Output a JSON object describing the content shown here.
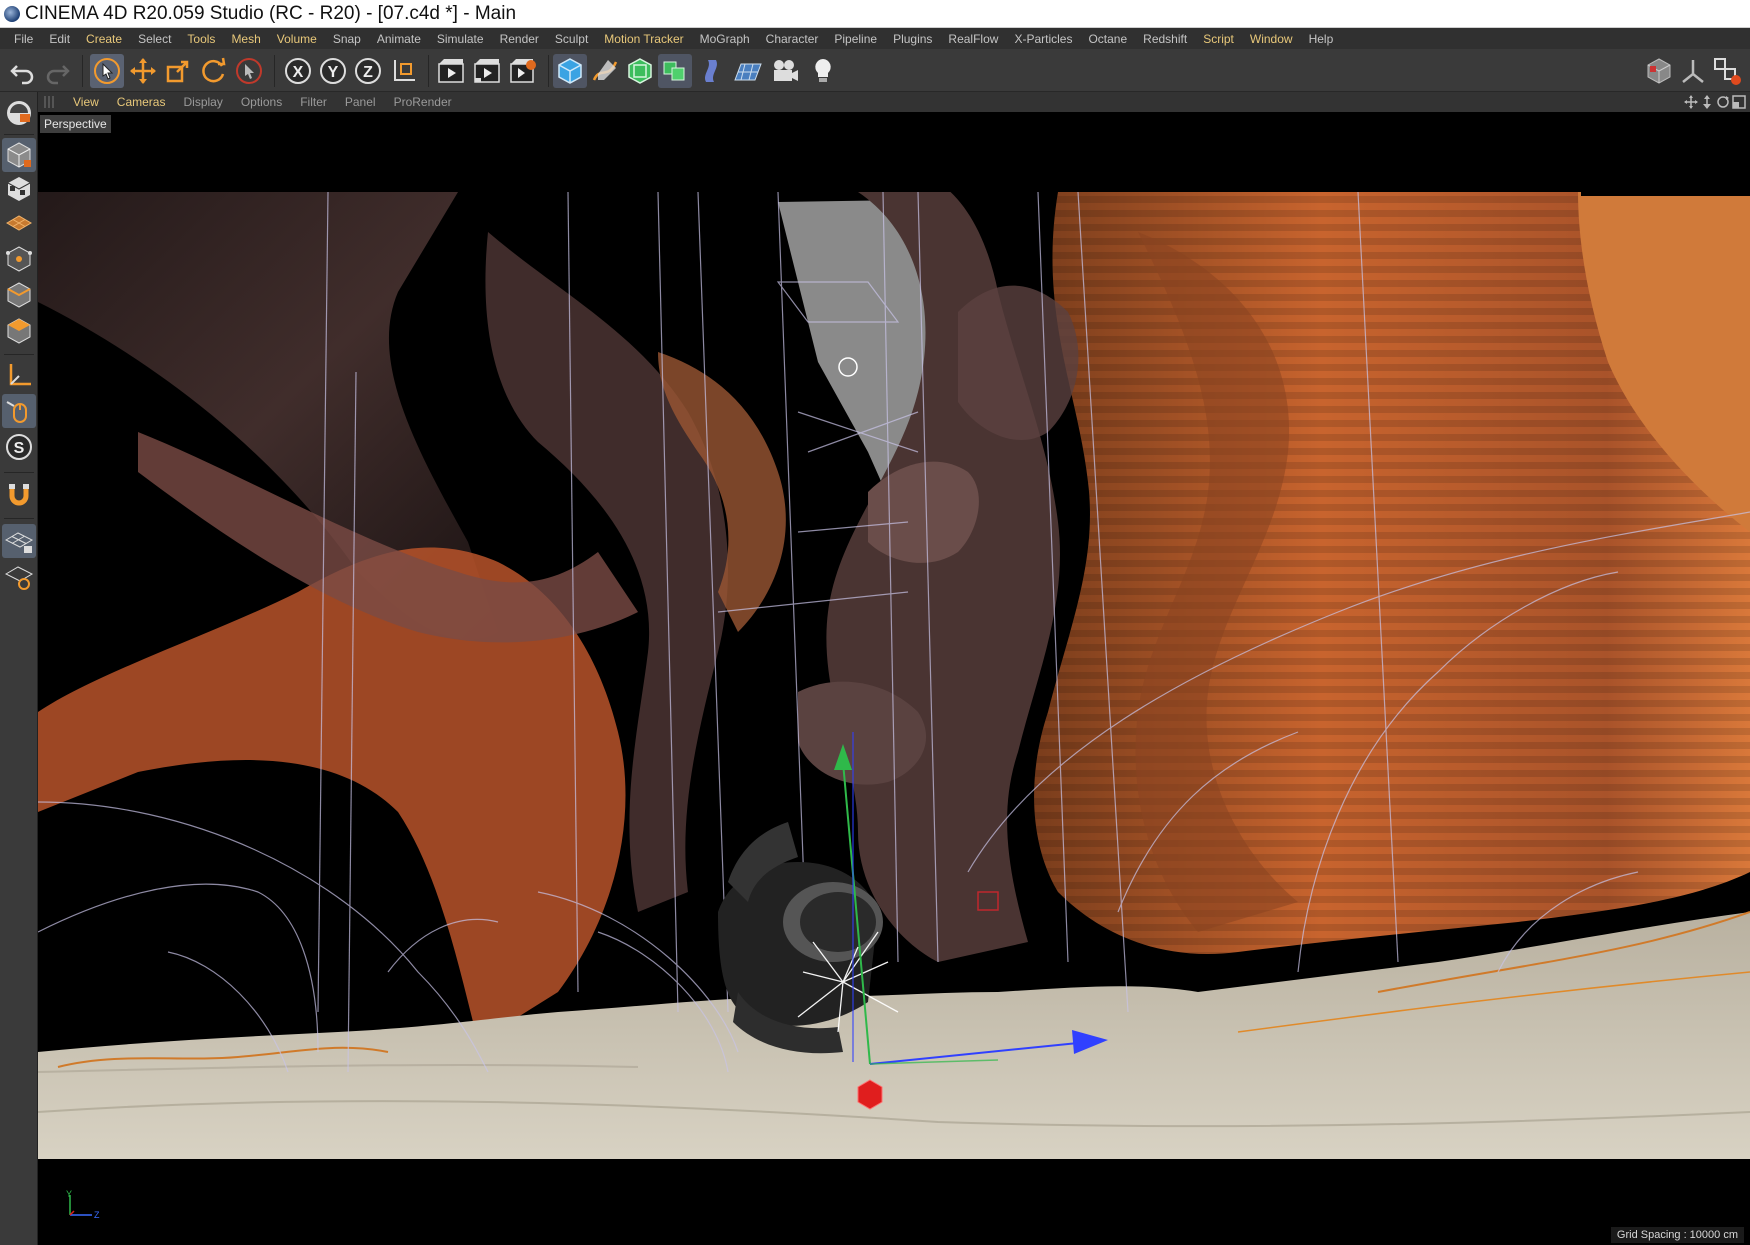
{
  "window": {
    "title": "CINEMA 4D R20.059 Studio (RC - R20) - [07.c4d *] - Main",
    "icon": "cinema4d-logo-icon"
  },
  "menubar": {
    "items": [
      {
        "label": "File",
        "highlight": false
      },
      {
        "label": "Edit",
        "highlight": false
      },
      {
        "label": "Create",
        "highlight": true
      },
      {
        "label": "Select",
        "highlight": false
      },
      {
        "label": "Tools",
        "highlight": true
      },
      {
        "label": "Mesh",
        "highlight": true
      },
      {
        "label": "Volume",
        "highlight": true
      },
      {
        "label": "Snap",
        "highlight": false
      },
      {
        "label": "Animate",
        "highlight": false
      },
      {
        "label": "Simulate",
        "highlight": false
      },
      {
        "label": "Render",
        "highlight": false
      },
      {
        "label": "Sculpt",
        "highlight": false
      },
      {
        "label": "Motion Tracker",
        "highlight": true
      },
      {
        "label": "MoGraph",
        "highlight": false
      },
      {
        "label": "Character",
        "highlight": false
      },
      {
        "label": "Pipeline",
        "highlight": false
      },
      {
        "label": "Plugins",
        "highlight": false
      },
      {
        "label": "RealFlow",
        "highlight": false
      },
      {
        "label": "X-Particles",
        "highlight": false
      },
      {
        "label": "Octane",
        "highlight": false
      },
      {
        "label": "Redshift",
        "highlight": false
      },
      {
        "label": "Script",
        "highlight": true
      },
      {
        "label": "Window",
        "highlight": true
      },
      {
        "label": "Help",
        "highlight": false
      }
    ]
  },
  "toolbar": {
    "buttons": [
      "undo-icon",
      "redo-icon",
      "live-selection-icon",
      "move-icon",
      "scale-icon",
      "rotate-icon",
      "recent-tool-icon",
      "x-axis-lock-icon",
      "y-axis-lock-icon",
      "z-axis-lock-icon",
      "coordinate-system-icon",
      "render-view-icon",
      "render-picture-viewer-icon",
      "edit-render-settings-icon",
      "cube-icon",
      "pen-spline-icon",
      "subdivision-surface-icon",
      "array-icon",
      "deformer-icon",
      "floor-icon",
      "camera-icon",
      "light-icon"
    ],
    "right_buttons": [
      "layout-icon",
      "snap-icon",
      "workplane-icon"
    ]
  },
  "left_palette": {
    "buttons": [
      "make-editable-icon",
      "texture-mode-icon",
      "workplane-mode-icon",
      "points-mode-icon",
      "edges-mode-icon",
      "polygons-mode-icon",
      "enable-axis-icon",
      "tweak-mode-icon",
      "solo-mode-icon",
      "snapping-icon",
      "workplane-lock-icon",
      "workplane-align-icon"
    ],
    "solo_glyph": "S"
  },
  "viewport_menu": {
    "items": [
      {
        "label": "View",
        "highlight": true
      },
      {
        "label": "Cameras",
        "highlight": true
      },
      {
        "label": "Display",
        "highlight": false
      },
      {
        "label": "Options",
        "highlight": false
      },
      {
        "label": "Filter",
        "highlight": false
      },
      {
        "label": "Panel",
        "highlight": false
      },
      {
        "label": "ProRender",
        "highlight": false
      }
    ],
    "controls": [
      "pan-icon",
      "zoom-icon",
      "orbit-icon",
      "maximize-icon"
    ]
  },
  "viewport": {
    "camera_label": "Perspective",
    "grid_spacing": "Grid Spacing : 10000 cm",
    "axis_labels": {
      "y": "Y",
      "z": "Z"
    }
  },
  "colors": {
    "accent": "#e8c87a",
    "rock": "#c8642e",
    "sand": "#cfc8b8",
    "viewport_bg": "#000000"
  }
}
